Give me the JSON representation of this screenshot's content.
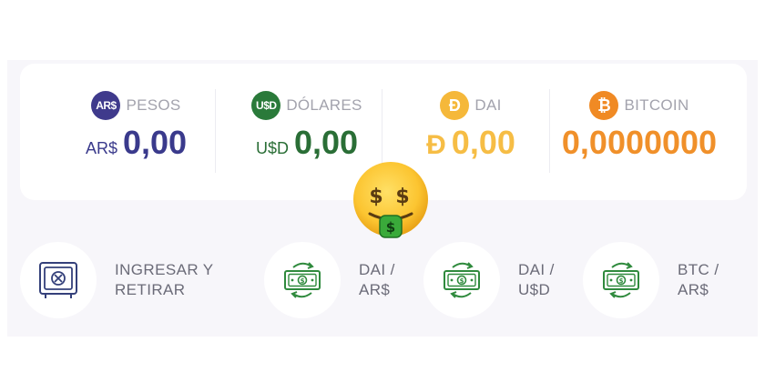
{
  "balances": [
    {
      "badge": "AR$",
      "name": "PESOS",
      "symbol": "AR$",
      "amount": "0,00"
    },
    {
      "badge": "U$D",
      "name": "DÓLARES",
      "symbol": "U$D",
      "amount": "0,00"
    },
    {
      "badge": "Ð",
      "name": "DAI",
      "symbol": "Ð",
      "amount": "0,00"
    },
    {
      "badge": "₿",
      "name": "BITCOIN",
      "symbol": "",
      "amount": "0,0000000"
    }
  ],
  "actions": [
    {
      "label": "INGRESAR Y\nRETIRAR",
      "icon": "safe-icon"
    },
    {
      "label": "DAI /\nAR$",
      "icon": "exchange-money-icon"
    },
    {
      "label": "DAI /\nU$D",
      "icon": "exchange-money-icon"
    },
    {
      "label": "BTC /\nAR$",
      "icon": "exchange-money-icon"
    }
  ],
  "colors": {
    "ars": "#3a3a8c",
    "usd": "#2a6e36",
    "dai": "#f6bd45",
    "btc": "#f0902a",
    "panel": "#f7f6fa"
  }
}
